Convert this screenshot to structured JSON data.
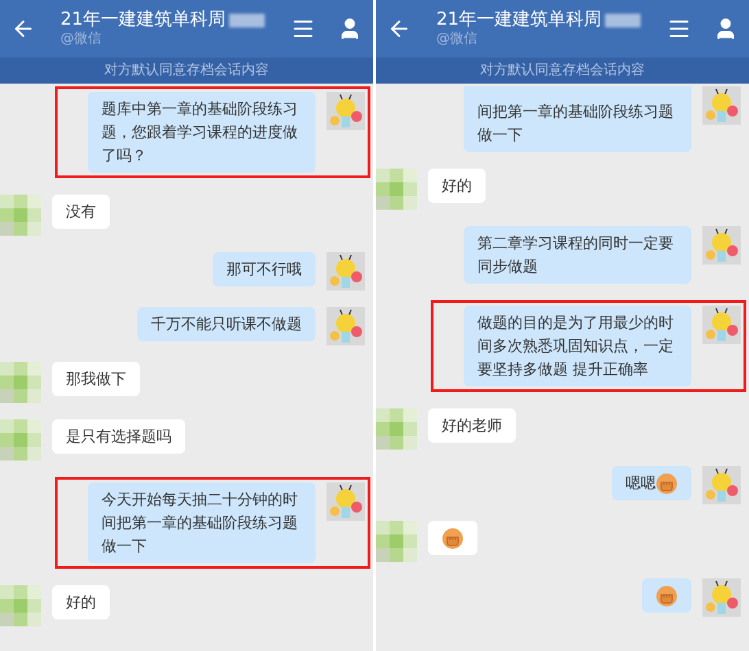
{
  "panels": [
    {
      "title": "21年一建建筑单科周",
      "subtitle": "@微信",
      "notice": "对方默认同意存档会话内容",
      "messages": [
        {
          "kind": "sent",
          "text": "题库中第一章的基础阶段练习题，您跟着学习课程的进度做了吗？",
          "highlighted": true,
          "emoji": false,
          "partial": false
        },
        {
          "kind": "received",
          "text": "没有",
          "highlighted": false,
          "emoji": false,
          "partial": false
        },
        {
          "kind": "sent",
          "text": "那可不行哦",
          "highlighted": false,
          "emoji": false,
          "partial": false
        },
        {
          "kind": "sent",
          "text": "千万不能只听课不做题",
          "highlighted": false,
          "emoji": false,
          "partial": false
        },
        {
          "kind": "received",
          "text": "那我做下",
          "highlighted": false,
          "emoji": false,
          "partial": false
        },
        {
          "kind": "received",
          "text": "是只有选择题吗",
          "highlighted": false,
          "emoji": false,
          "partial": false
        },
        {
          "kind": "sent",
          "text": "今天开始每天抽二十分钟的时间把第一章的基础阶段练习题做一下",
          "highlighted": true,
          "emoji": false,
          "partial": false
        },
        {
          "kind": "received",
          "text": "好的",
          "highlighted": false,
          "emoji": false,
          "partial": false
        }
      ]
    },
    {
      "title": "21年一建建筑单科周",
      "subtitle": "@微信",
      "notice": "对方默认同意存档会话内容",
      "messages": [
        {
          "kind": "sent",
          "text": "间把第一章的基础阶段练习题做一下",
          "highlighted": false,
          "emoji": false,
          "partial": true
        },
        {
          "kind": "received",
          "text": "好的",
          "highlighted": false,
          "emoji": false,
          "partial": false
        },
        {
          "kind": "sent",
          "text": "第二章学习课程的同时一定要同步做题",
          "highlighted": false,
          "emoji": false,
          "partial": false
        },
        {
          "kind": "sent",
          "text": "做题的目的是为了用最少的时间多次熟悉巩固知识点，一定要坚持多做题 提升正确率",
          "highlighted": true,
          "emoji": false,
          "partial": false
        },
        {
          "kind": "received",
          "text": "好的老师",
          "highlighted": false,
          "emoji": false,
          "partial": false
        },
        {
          "kind": "sent",
          "text": "嗯嗯",
          "highlighted": false,
          "emoji": true,
          "partial": false
        },
        {
          "kind": "received",
          "highlighted": false,
          "emoji": true,
          "partial": false
        },
        {
          "kind": "sent",
          "highlighted": false,
          "emoji": true,
          "partial": false
        }
      ]
    }
  ]
}
